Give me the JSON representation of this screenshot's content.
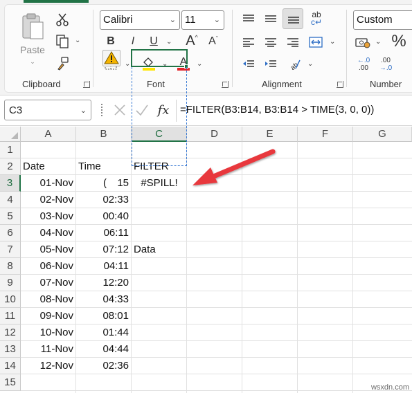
{
  "ribbon": {
    "clipboard": {
      "label": "Clipboard",
      "paste_label": "Paste"
    },
    "font": {
      "label": "Font",
      "font_name": "Calibri",
      "font_size": "11",
      "bold": "B",
      "italic": "I",
      "underline": "U",
      "grow_font": "A",
      "shrink_font": "A"
    },
    "alignment": {
      "label": "Alignment"
    },
    "number": {
      "label": "Number",
      "format": "Custom",
      "percent": "%",
      "inc_decimals": ".0 .00",
      "dec_decimals": ".00 .0"
    }
  },
  "formula_bar": {
    "name_box": "C3",
    "fx": "fx",
    "formula": "=FILTER(B3:B14, B3:B14 > TIME(3, 0, 0))"
  },
  "sheet": {
    "columns": [
      "A",
      "B",
      "C",
      "D",
      "E",
      "F",
      "G"
    ],
    "rows": [
      "1",
      "2",
      "3",
      "4",
      "5",
      "6",
      "7",
      "8",
      "9",
      "10",
      "11",
      "12",
      "13",
      "14",
      "15"
    ],
    "headers": {
      "date": "Date",
      "time": "Time",
      "filter": "FILTER"
    },
    "dates": [
      "01-Nov",
      "02-Nov",
      "03-Nov",
      "04-Nov",
      "05-Nov",
      "06-Nov",
      "07-Nov",
      "08-Nov",
      "09-Nov",
      "10-Nov",
      "11-Nov",
      "12-Nov"
    ],
    "times": [
      "(",
      "02:33",
      "00:40",
      "06:11",
      "07:12",
      "04:11",
      "12:20",
      "04:33",
      "08:01",
      "01:44",
      "04:44",
      "02:36"
    ],
    "time_b3_tail": "15",
    "c3": "#SPILL!",
    "c7": "Data"
  },
  "watermark": "wsxdn.com",
  "colors": {
    "excel_green": "#217346",
    "arrow_red": "#e8383d",
    "spill_border": "#3b7bd4"
  }
}
